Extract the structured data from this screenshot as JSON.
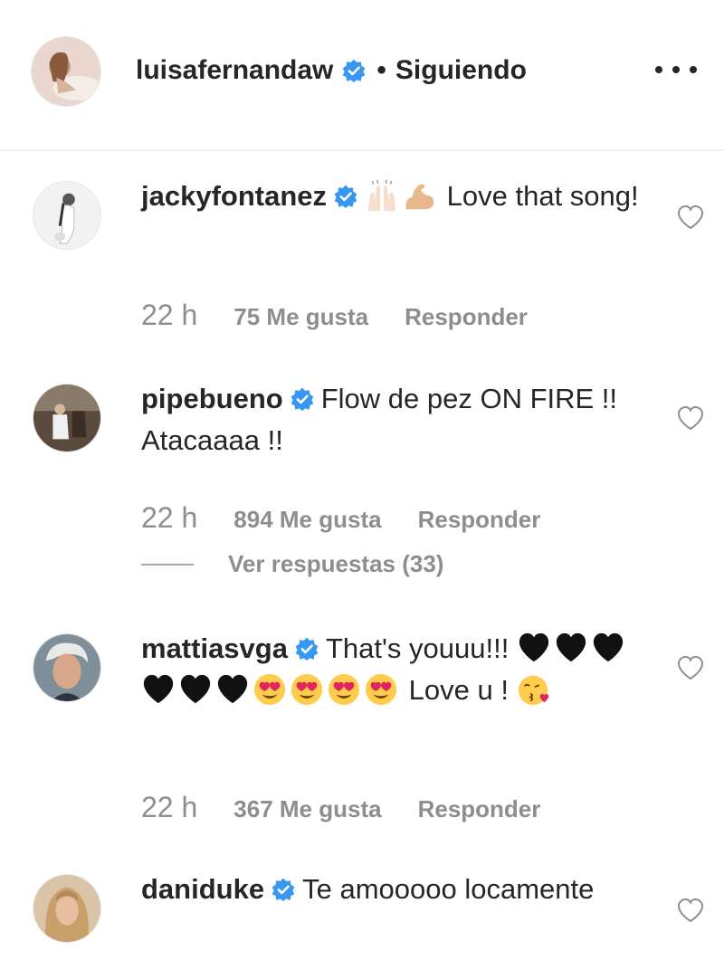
{
  "post_header": {
    "username": "luisafernandaw",
    "separator": "•",
    "follow_status": "Siguiendo",
    "more_icon": "more-horizontal-icon"
  },
  "comments": [
    {
      "username": "jackyfontanez",
      "emojis": [
        "raising-hands",
        "flexed-biceps"
      ],
      "text": "Love that song!",
      "time": "22 h",
      "likes": "75 Me gusta",
      "reply": "Responder"
    },
    {
      "username": "pipebueno",
      "text": "Flow de pez ON FIRE !! Atacaaaa !!",
      "time": "22 h",
      "likes": "894 Me gusta",
      "reply": "Responder",
      "view_replies": "Ver respuestas (33)"
    },
    {
      "username": "mattiasvga",
      "text_before": "That's youuu!!!",
      "emojis": [
        "black-heart x6",
        "heart-eyes x4"
      ],
      "text_after": "Love u !",
      "emoji_end": "kissing-heart",
      "time": "22 h",
      "likes": "367 Me gusta",
      "reply": "Responder"
    },
    {
      "username": "daniduke",
      "text": "Te amooooo locamente"
    }
  ],
  "colors": {
    "verified_blue": "#3897f0",
    "muted_text": "#8e8e8e",
    "primary_text": "#262626"
  }
}
